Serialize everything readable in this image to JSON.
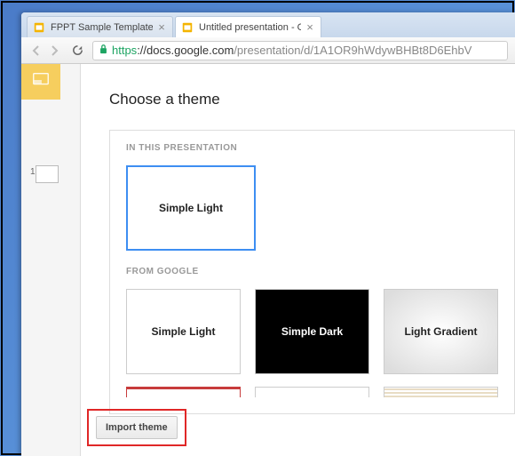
{
  "tabs": [
    {
      "title": "FPPT Sample Template - G",
      "active": false,
      "favicon": "slides-orange"
    },
    {
      "title": "Untitled presentation - Go",
      "active": true,
      "favicon": "slides-yellow"
    }
  ],
  "url": {
    "scheme": "https",
    "host": "://docs.google.com",
    "path": "/presentation/d/1A1OR9hWdywBHBt8D6EhbV"
  },
  "slides": {
    "current_index": "1"
  },
  "dialog": {
    "title": "Choose a theme",
    "sections": {
      "in_presentation": {
        "label": "IN THIS PRESENTATION",
        "themes": [
          {
            "name": "Simple Light",
            "variant": "light",
            "selected": true
          }
        ]
      },
      "from_google": {
        "label": "FROM GOOGLE",
        "themes": [
          {
            "name": "Simple Light",
            "variant": "light",
            "selected": false
          },
          {
            "name": "Simple Dark",
            "variant": "dark",
            "selected": false
          },
          {
            "name": "Light Gradient",
            "variant": "gradient",
            "selected": false
          }
        ]
      }
    },
    "import_label": "Import theme"
  }
}
